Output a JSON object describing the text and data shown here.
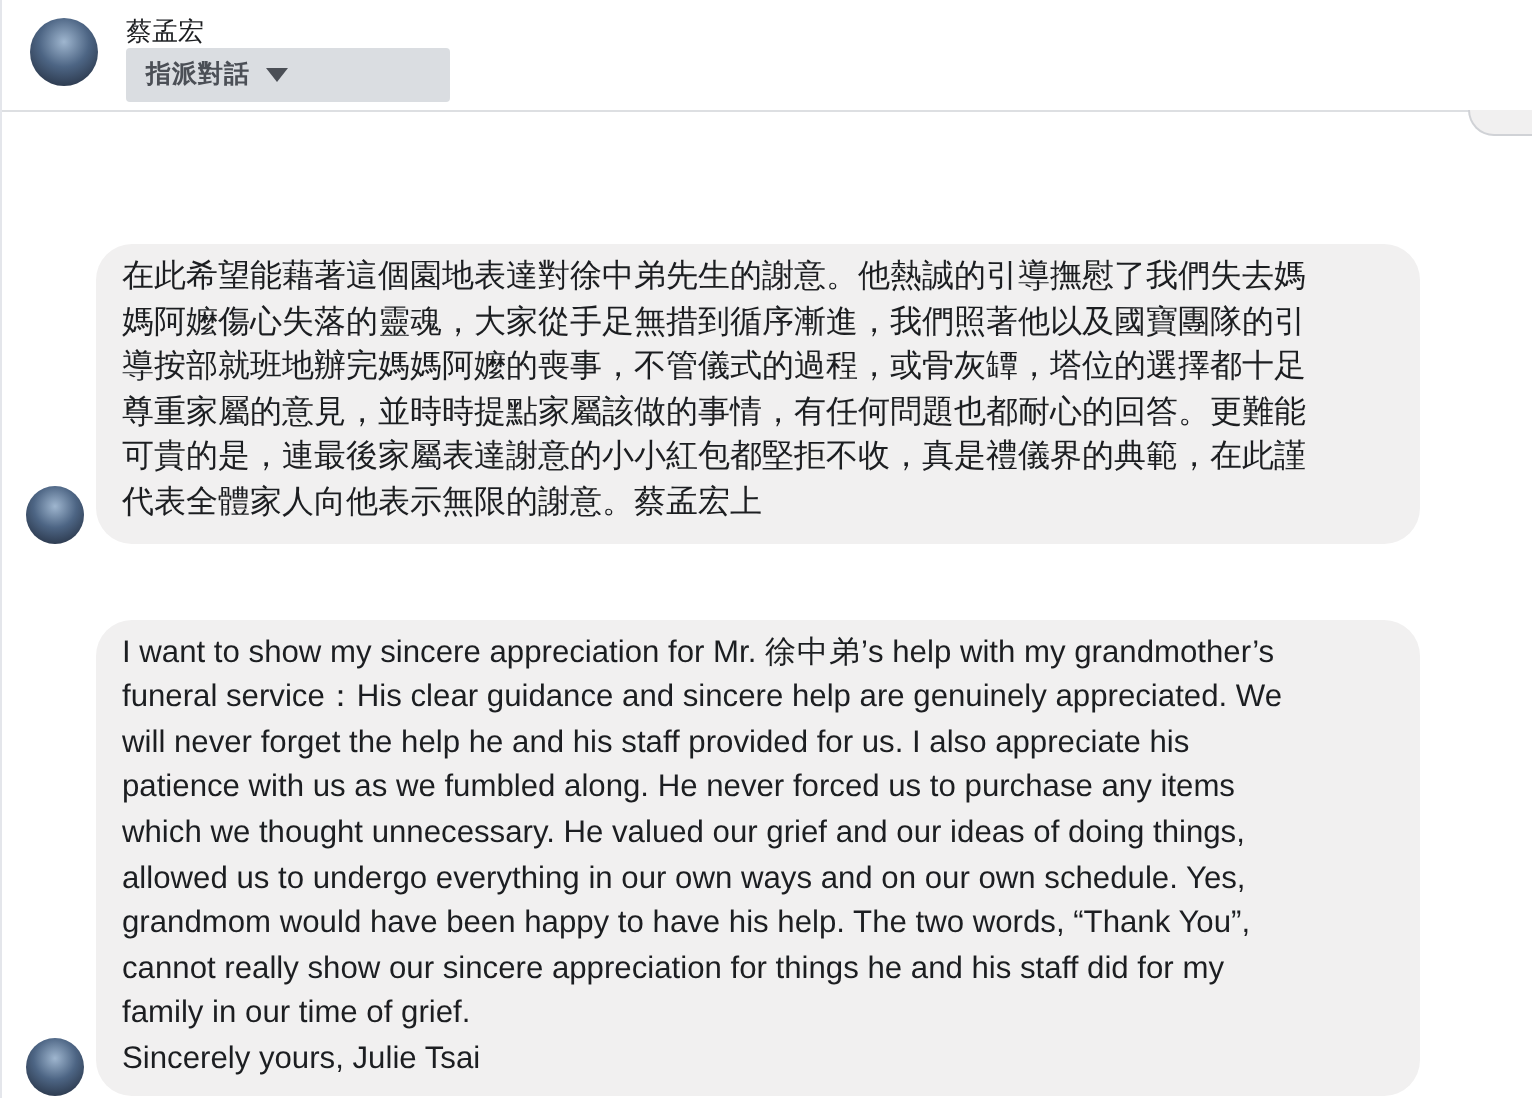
{
  "header": {
    "name": "蔡孟宏",
    "assign_button": "指派對話"
  },
  "messages": [
    {
      "lines": [
        "在此希望能藉著這個園地表達對徐中弟先生的謝意。他熱誠的引導撫慰了我們失去媽",
        "媽阿嬤傷心失落的靈魂，大家從手足無措到循序漸進，我們照著他以及國寶團隊的引",
        "導按部就班地辦完媽媽阿嬤的喪事，不管儀式的過程，或骨灰罈，塔位的選擇都十足",
        "尊重家屬的意見，並時時提點家屬該做的事情，有任何問題也都耐心的回答。更難能",
        "可貴的是，連最後家屬表達謝意的小小紅包都堅拒不收，真是禮儀界的典範，在此謹",
        "代表全體家人向他表示無限的謝意。蔡孟宏上"
      ]
    },
    {
      "lines": [
        "I want to show my sincere appreciation for Mr. 徐中弟’s help with my grandmother’s",
        "funeral service：His clear guidance and sincere help are genuinely appreciated. We",
        "will never forget the help he and his staff provided for us. I also appreciate his",
        "patience with us as we fumbled along. He never forced us to purchase any items",
        "which we thought unnecessary. He valued our grief and our ideas of doing things,",
        "allowed us to undergo everything in our own ways and on our own schedule. Yes,",
        "grandmom would have been happy to have his help. The two words, “Thank You”,",
        "cannot really show our sincere appreciation for things he and his staff did for my",
        "family in our time of grief.",
        "Sincerely yours, Julie Tsai"
      ]
    }
  ]
}
